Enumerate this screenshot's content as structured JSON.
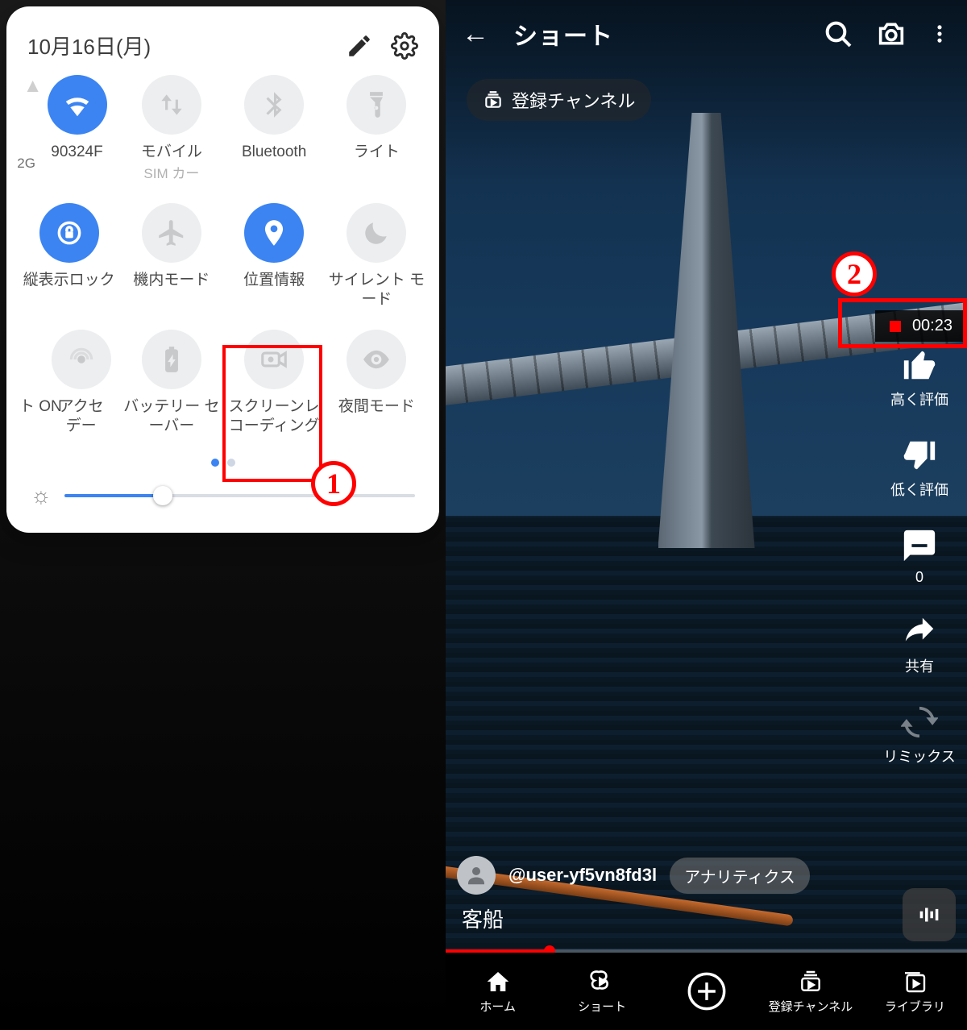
{
  "annotations": {
    "badge1": "1",
    "badge2": "2"
  },
  "left": {
    "date": "10月16日(月)",
    "tiles": {
      "wifi": {
        "label": "90324F",
        "g": "2G"
      },
      "mobile": {
        "label": "モバイル",
        "sub": "SIM カー"
      },
      "bt": {
        "label": "Bluetooth"
      },
      "flash": {
        "label": "ライト"
      },
      "rotate": {
        "label": "縦表示ロック"
      },
      "plane": {
        "label": "機内モード"
      },
      "loc": {
        "label": "位置情報"
      },
      "silent": {
        "label": "サイレント モード"
      },
      "hotspot": {
        "pre": "ト\nON",
        "label": "アクセ\nデー"
      },
      "battery": {
        "label": "バッテリー セーバー"
      },
      "screc": {
        "label": "スクリーンレコーディング"
      },
      "night": {
        "label": "夜間モード"
      }
    }
  },
  "right": {
    "title": "ショート",
    "chip": "登録チャンネル",
    "rec_time": "00:23",
    "actions": {
      "like": "高く評価",
      "dislike": "低く評価",
      "comments_count": "0",
      "share": "共有",
      "remix": "リミックス"
    },
    "user": "@user-yf5vn8fd3l",
    "pill": "アナリティクス",
    "caption": "客船",
    "nav": {
      "home": "ホーム",
      "shorts": "ショート",
      "subs": "登録チャンネル",
      "library": "ライブラリ"
    }
  }
}
